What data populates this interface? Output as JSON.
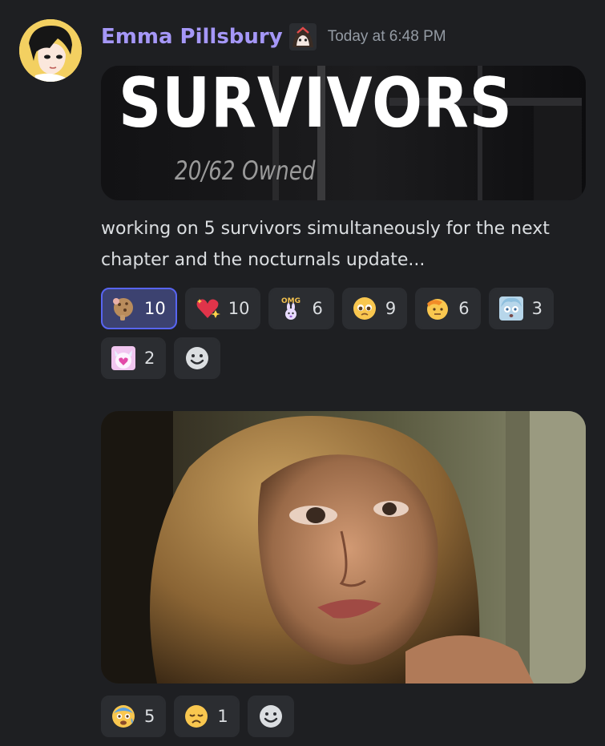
{
  "message": {
    "author": "Emma Pillsbury",
    "timestamp": "Today at 6:48 PM",
    "banner": {
      "title": "SURVIVORS",
      "subtitle": "20/62 Owned"
    },
    "text": "working on 5 survivors simultaneously for the next chapter and the nocturnals update..."
  },
  "reactions_top": [
    {
      "emoji": "cookie-thinking-emoji",
      "count": "10",
      "me": true
    },
    {
      "emoji": "sparkling-heart-emoji",
      "count": "10",
      "me": false
    },
    {
      "emoji": "omg-bunny-emoji",
      "count": "6",
      "me": false
    },
    {
      "emoji": "pleading-face-emoji",
      "count": "9",
      "me": false
    },
    {
      "emoji": "saluting-face-emoji",
      "count": "6",
      "me": false
    },
    {
      "emoji": "anime-shocked-emoji",
      "count": "3",
      "me": false
    },
    {
      "emoji": "heart-cat-emoji",
      "count": "2",
      "me": false
    }
  ],
  "reactions_bottom": [
    {
      "emoji": "anxious-face-emoji",
      "count": "5",
      "me": false
    },
    {
      "emoji": "disappointed-face-emoji",
      "count": "1",
      "me": false
    }
  ],
  "colors": {
    "background": "#1e1f22",
    "username": "#a597f7",
    "reaction_bg": "#2b2d31",
    "reaction_me_bg": "#3c4270",
    "reaction_me_border": "#5865f2"
  }
}
